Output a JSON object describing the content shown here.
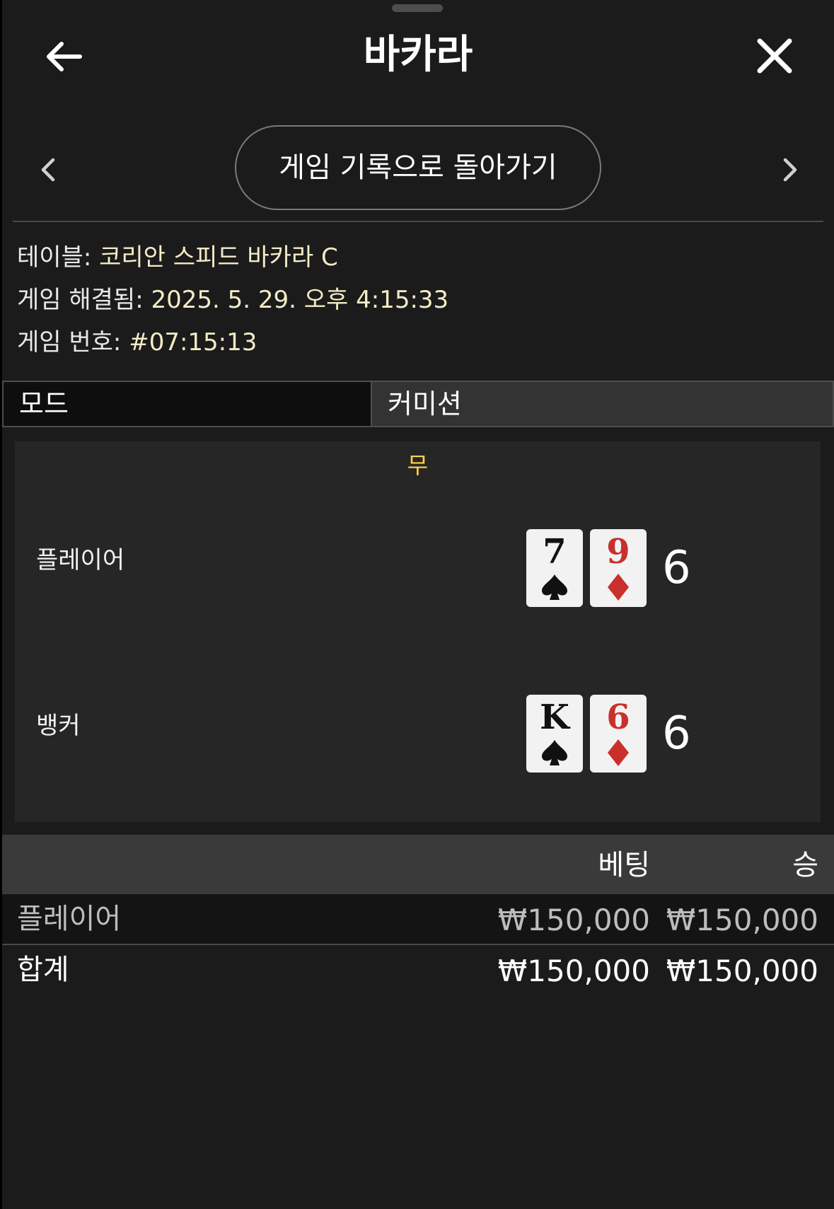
{
  "header": {
    "title": "바카라"
  },
  "nav": {
    "back_to_history_label": "게임 기록으로 돌아가기"
  },
  "info": {
    "table_label": "테이블:",
    "table_value": "코리안 스피드 바카라 C",
    "resolved_label": "게임 해결됨:",
    "resolved_value": "2025. 5. 29. 오후 4:15:33",
    "game_no_label": "게임 번호:",
    "game_no_value": "#07:15:13"
  },
  "tabs": [
    {
      "label": "모드",
      "active": true
    },
    {
      "label": "커미션",
      "active": false
    }
  ],
  "result": {
    "outcome": "무",
    "player": {
      "label": "플레이어",
      "cards": [
        {
          "rank": "7",
          "suit": "spade",
          "color": "black"
        },
        {
          "rank": "9",
          "suit": "diamond",
          "color": "red"
        }
      ],
      "total": "6"
    },
    "banker": {
      "label": "뱅커",
      "cards": [
        {
          "rank": "K",
          "suit": "spade",
          "color": "black"
        },
        {
          "rank": "6",
          "suit": "diamond",
          "color": "red"
        }
      ],
      "total": "6"
    }
  },
  "bets": {
    "columns": {
      "bet": "베팅",
      "win": "승"
    },
    "rows": [
      {
        "label": "플레이어",
        "bet": "₩150,000",
        "win": "₩150,000"
      }
    ],
    "total": {
      "label": "합계",
      "bet": "₩150,000",
      "win": "₩150,000"
    }
  },
  "colors": {
    "background": "#1b1b1b",
    "accent_yellow": "#ffd34d",
    "info_value": "#f4ecc6",
    "red_suit": "#c9302c"
  }
}
